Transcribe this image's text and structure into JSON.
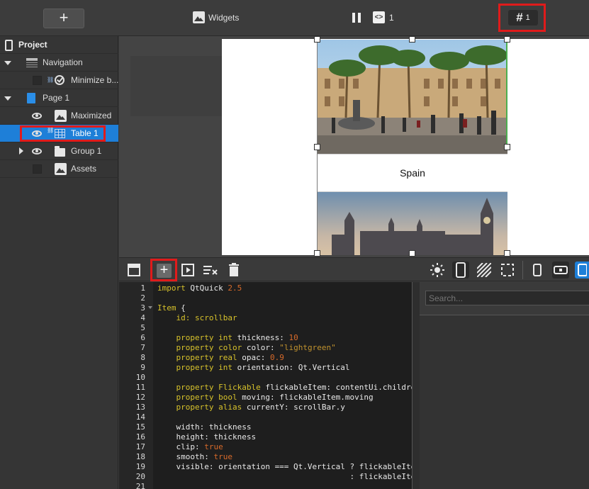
{
  "topbar": {
    "add_label": "+",
    "widgets_label": "Widgets",
    "code_count": "1",
    "hash_symbol": "#",
    "hash_count": "1"
  },
  "tree": {
    "header": "Project",
    "items": [
      {
        "label": "Navigation"
      },
      {
        "label": "Minimize b..."
      },
      {
        "label": "Page 1"
      },
      {
        "label": "Maximized"
      },
      {
        "label": "Table 1"
      },
      {
        "label": "Group 1"
      },
      {
        "label": "Assets"
      }
    ]
  },
  "canvas": {
    "cell_text": "Spain"
  },
  "search": {
    "placeholder": "Search..."
  },
  "editor": {
    "line_numbers": [
      "1",
      "2",
      "3",
      "4",
      "5",
      "6",
      "7",
      "8",
      "9",
      "10",
      "11",
      "12",
      "13",
      "14",
      "15",
      "16",
      "17",
      "18",
      "19",
      "20",
      "21"
    ]
  },
  "colors": {
    "accent": "#1e7fd8",
    "highlight": "#e01b1b",
    "keyword": "#d7c22b",
    "string": "#c0922e",
    "number": "#d86a2a"
  }
}
